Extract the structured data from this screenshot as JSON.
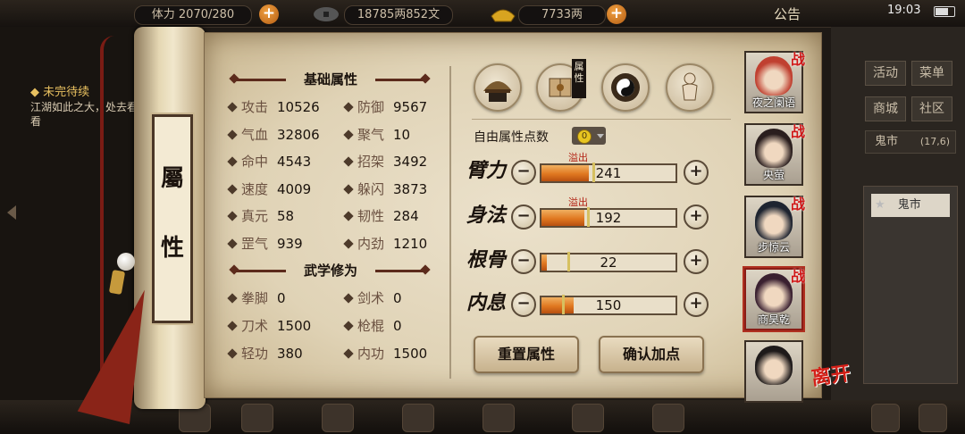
{
  "topbar": {
    "stamina": "体力 2070/280",
    "money": "18785两852文",
    "gold": "7733两",
    "notice": "公告",
    "time": "19:03"
  },
  "left_panel": {
    "quest_title": "未完待续",
    "quest_text": "江湖如此之大，处去看看"
  },
  "right_panel": {
    "buttons": [
      "活动",
      "菜单",
      "商城",
      "社区"
    ],
    "location": "鬼市",
    "location_coords": "(17,6)",
    "list_item": "鬼市"
  },
  "scroll": {
    "label_char1": "屬",
    "label_char2": "性"
  },
  "basic_attributes": {
    "title": "基础属性",
    "items": [
      {
        "label": "攻击",
        "value": "10526"
      },
      {
        "label": "防御",
        "value": "9567"
      },
      {
        "label": "气血",
        "value": "32806"
      },
      {
        "label": "聚气",
        "value": "10"
      },
      {
        "label": "命中",
        "value": "4543"
      },
      {
        "label": "招架",
        "value": "3492"
      },
      {
        "label": "速度",
        "value": "4009"
      },
      {
        "label": "躲闪",
        "value": "3873"
      },
      {
        "label": "真元",
        "value": "58"
      },
      {
        "label": "韧性",
        "value": "284"
      },
      {
        "label": "罡气",
        "value": "939"
      },
      {
        "label": "内劲",
        "value": "1210"
      }
    ]
  },
  "martial": {
    "title": "武学修为",
    "items": [
      {
        "label": "拳脚",
        "value": "0"
      },
      {
        "label": "剑术",
        "value": "0"
      },
      {
        "label": "刀术",
        "value": "1500"
      },
      {
        "label": "枪棍",
        "value": "0"
      },
      {
        "label": "轻功",
        "value": "380"
      },
      {
        "label": "内功",
        "value": "1500"
      }
    ]
  },
  "tabs": {
    "attribute_tag": "属性"
  },
  "free_points": {
    "label": "自由属性点数",
    "value": "0"
  },
  "allocations": [
    {
      "name": "臂力",
      "value": "241",
      "overflow": "溢出",
      "fill": 0.35,
      "needle": 0.38
    },
    {
      "name": "身法",
      "value": "192",
      "overflow": "溢出",
      "fill": 0.32,
      "needle": 0.34
    },
    {
      "name": "根骨",
      "value": "22",
      "overflow": "",
      "fill": 0.04,
      "needle": 0.19
    },
    {
      "name": "内息",
      "value": "150",
      "overflow": "",
      "fill": 0.24,
      "needle": 0.15
    }
  ],
  "actions": {
    "reset": "重置属性",
    "confirm": "确认加点"
  },
  "party": [
    {
      "name": "夜之阑语",
      "zhan": "战"
    },
    {
      "name": "央萤",
      "zhan": "战"
    },
    {
      "name": "步惊云",
      "zhan": "战"
    },
    {
      "name": "商昊乾",
      "zhan": "战"
    },
    {
      "name": "",
      "zhan": ""
    }
  ],
  "leave": "离开",
  "colors": {
    "bar_fill": "#e07820",
    "overflow_text": "#b22012",
    "zhan": "#d01818"
  }
}
